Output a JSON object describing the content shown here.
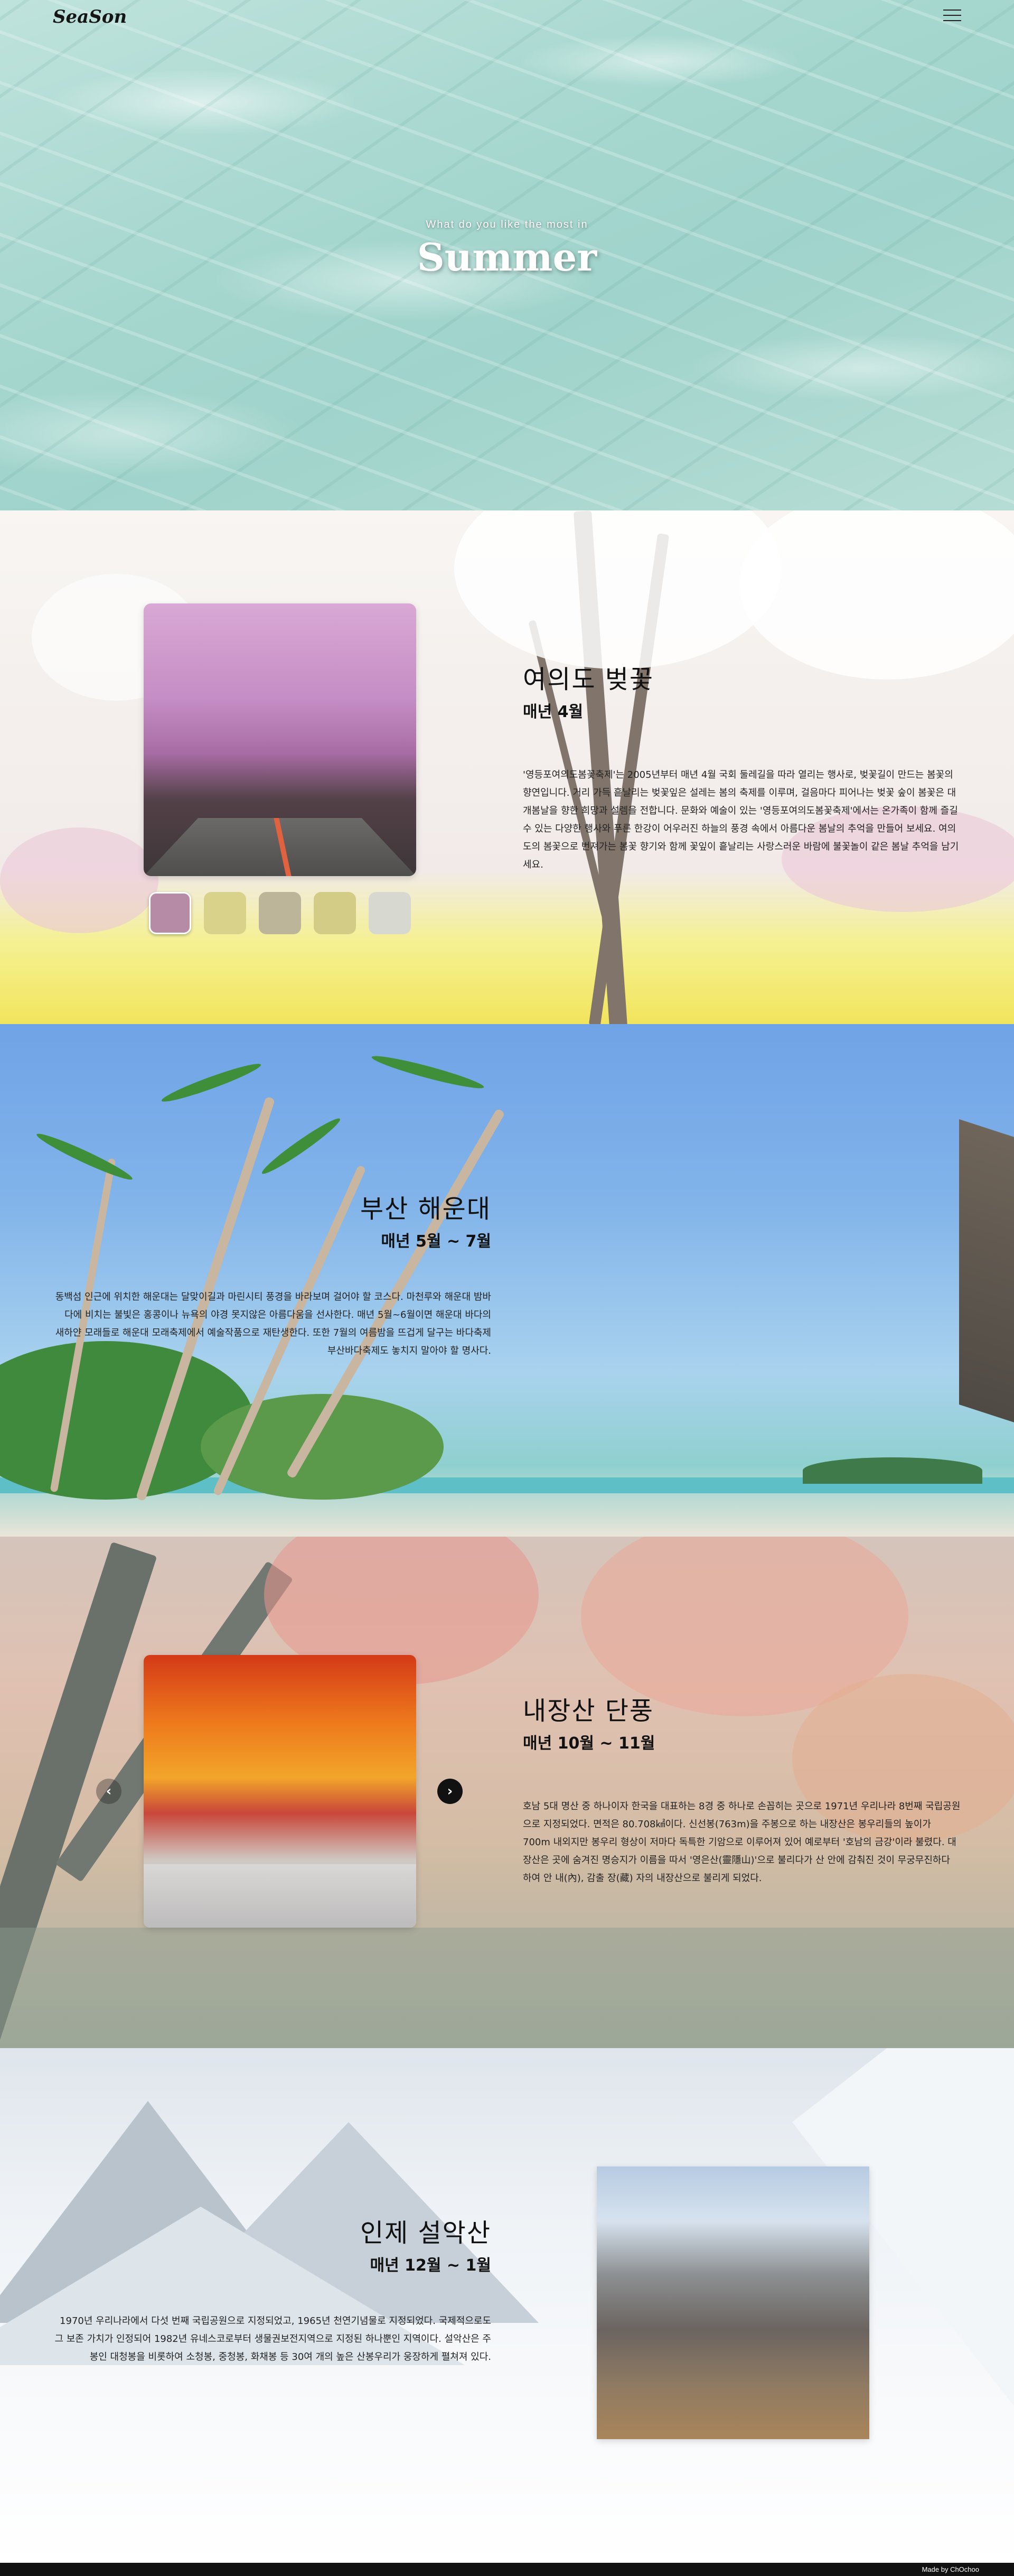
{
  "header": {
    "logo": "SeaSon",
    "hero_subtitle": "What do you like the most in",
    "hero_title": "Summer"
  },
  "seasons": [
    {
      "id": "spring",
      "title": "여의도 벚꽃",
      "period": "매년 4월",
      "description": "'영등포여의도봄꽃축제'는 2005년부터 매년 4월 국회 둘레길을 따라 열리는 행사로, 벚꽃길이 만드는 봄꽃의 향연입니다. 거리 가득 흩날리는 벚꽃잎은 설레는 봄의 축제를 이루며, 걸음마다 피어나는 벚꽃 숲이 봄꽃은 대개봄날을 향한 희망과 설렘을 전합니다. 문화와 예술이 있는 '영등포여의도봄꽃축제'에서는 온가족이 함께 즐길 수 있는 다양한 행사와 푸른 한강이 어우러진 하늘의 풍경 속에서 아름다운 봄날의 추억을 만들어 보세요. 여의도의 봄꽃으로 번져가는 봄꽃 향기와 함께 꽃잎이 흩날리는 사랑스러운 바람에 불꽃놀이 같은 봄날 추억을 남기세요."
    },
    {
      "id": "summer",
      "title": "부산 해운대",
      "period": "매년 5월 ~ 7월",
      "description": "동백섬 인근에 위치한 해운대는 달맞이길과 마린시티 풍경을 바라보며 걸어야 할 코스다. 마천루와 해운대 밤바다에 비치는 불빛은 홍콩이나 뉴욕의 야경 못지않은 아름다움을 선사한다. 매년 5월~6월이면 해운대 바다의 새하얀 모래들로 해운대 모래축제에서 예술작품으로 재탄생한다. 또한 7월의 여름밤을 뜨겁게 달구는 바다축제 부산바다축제도 놓치지 말아야 할 명사다."
    },
    {
      "id": "autumn",
      "title": "내장산 단풍",
      "period": "매년 10월 ~ 11월",
      "description": "호남 5대 명산 중 하나이자 한국을 대표하는 8경 중 하나로 손꼽히는 곳으로 1971년 우리나라 8번째 국립공원으로 지정되었다. 면적은 80.708㎢이다. 신선봉(763m)을 주봉으로 하는 내장산은 봉우리들의 높이가 700m 내외지만 봉우리 형상이 저마다 독특한 기암으로 이루어져 있어 예로부터 '호남의 금강'이라 불렸다. 대장산은 곳에 숨겨진 명승지가 이름을 따서 '영은산(靈隱山)'으로 불리다가 산 안에 감춰진 것이 무궁무진하다 하여 안 내(內), 감출 장(藏) 자의 내장산으로 불리게 되었다."
    },
    {
      "id": "winter",
      "title": "인제 설악산",
      "period": "매년 12월 ~ 1월",
      "description": "1970년 우리나라에서 다섯 번째 국립공원으로 지정되었고, 1965년 천연기념물로 지정되었다. 국제적으로도 그 보존 가치가 인정되어 1982년 유네스코로부터 생물권보전지역으로 지정된 하나뿐인 지역이다. 설악산은 주봉인 대청봉을 비롯하여 소청봉, 중청봉, 화채봉 등 30여 개의 높은 산봉우리가 웅장하게 펼쳐져 있다."
    }
  ],
  "thumbnail_colors": [
    "#b58ba6",
    "#d9d28a",
    "#bdb59a",
    "#d2cc86",
    "#d7d9d1"
  ],
  "footer": {
    "credit": "Made by ChOchoo"
  }
}
